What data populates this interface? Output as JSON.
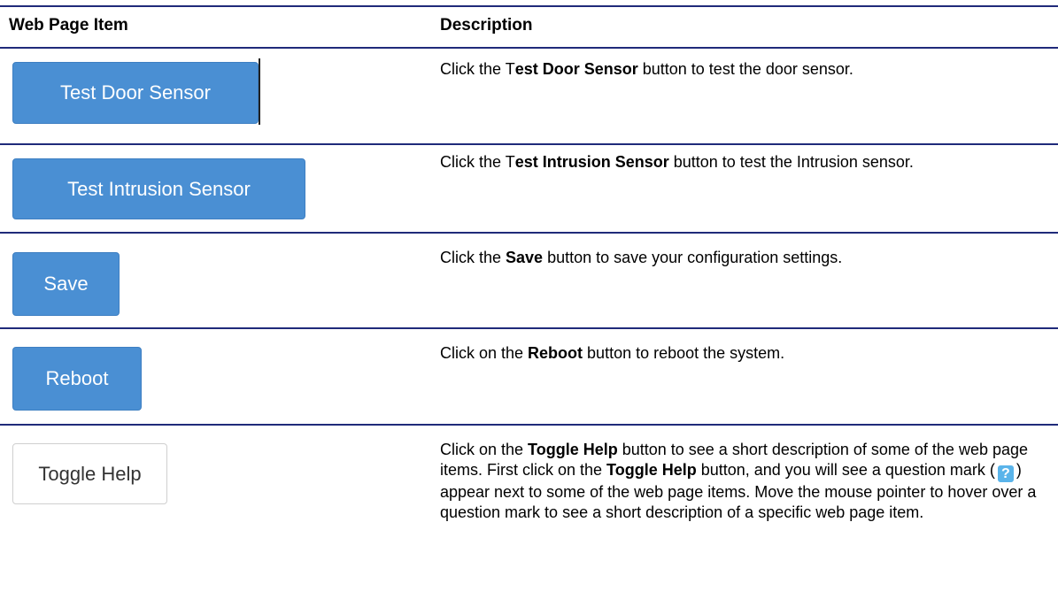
{
  "header": {
    "item_label": "Web Page Item",
    "description_label": "Description"
  },
  "rows": [
    {
      "button_label": "Test Door Sensor",
      "desc": {
        "pre": "Click the T",
        "bold": "est Door Sensor",
        "post": " button to test the door sensor."
      }
    },
    {
      "button_label": "Test Intrusion Sensor",
      "desc": {
        "pre": "Click the T",
        "bold": "est Intrusion Sensor",
        "post": " button to test the Intrusion sensor."
      }
    },
    {
      "button_label": "Save",
      "desc": {
        "pre": "Click the ",
        "bold": "Save",
        "post": " button to save your configuration settings."
      }
    },
    {
      "button_label": "Reboot",
      "desc": {
        "pre": "Click on the ",
        "bold": "Reboot",
        "post": " button to reboot the system."
      }
    },
    {
      "button_label": "Toggle Help",
      "desc": {
        "p1": "Click on the ",
        "b1": "Toggle Help",
        "p2": " button to see a short description of some of the web page items. First click on the ",
        "b2": "Toggle Help",
        "p3": " button, and you will see a question mark (",
        "icon": "?",
        "p4": ") appear next to some of the web page items. Move the mouse pointer to hover over a question mark to see a short description of a specific web page item."
      }
    }
  ],
  "colors": {
    "rule": "#1f2a7a",
    "primary_button": "#4a8fd3",
    "help_icon": "#5ab4ea"
  }
}
